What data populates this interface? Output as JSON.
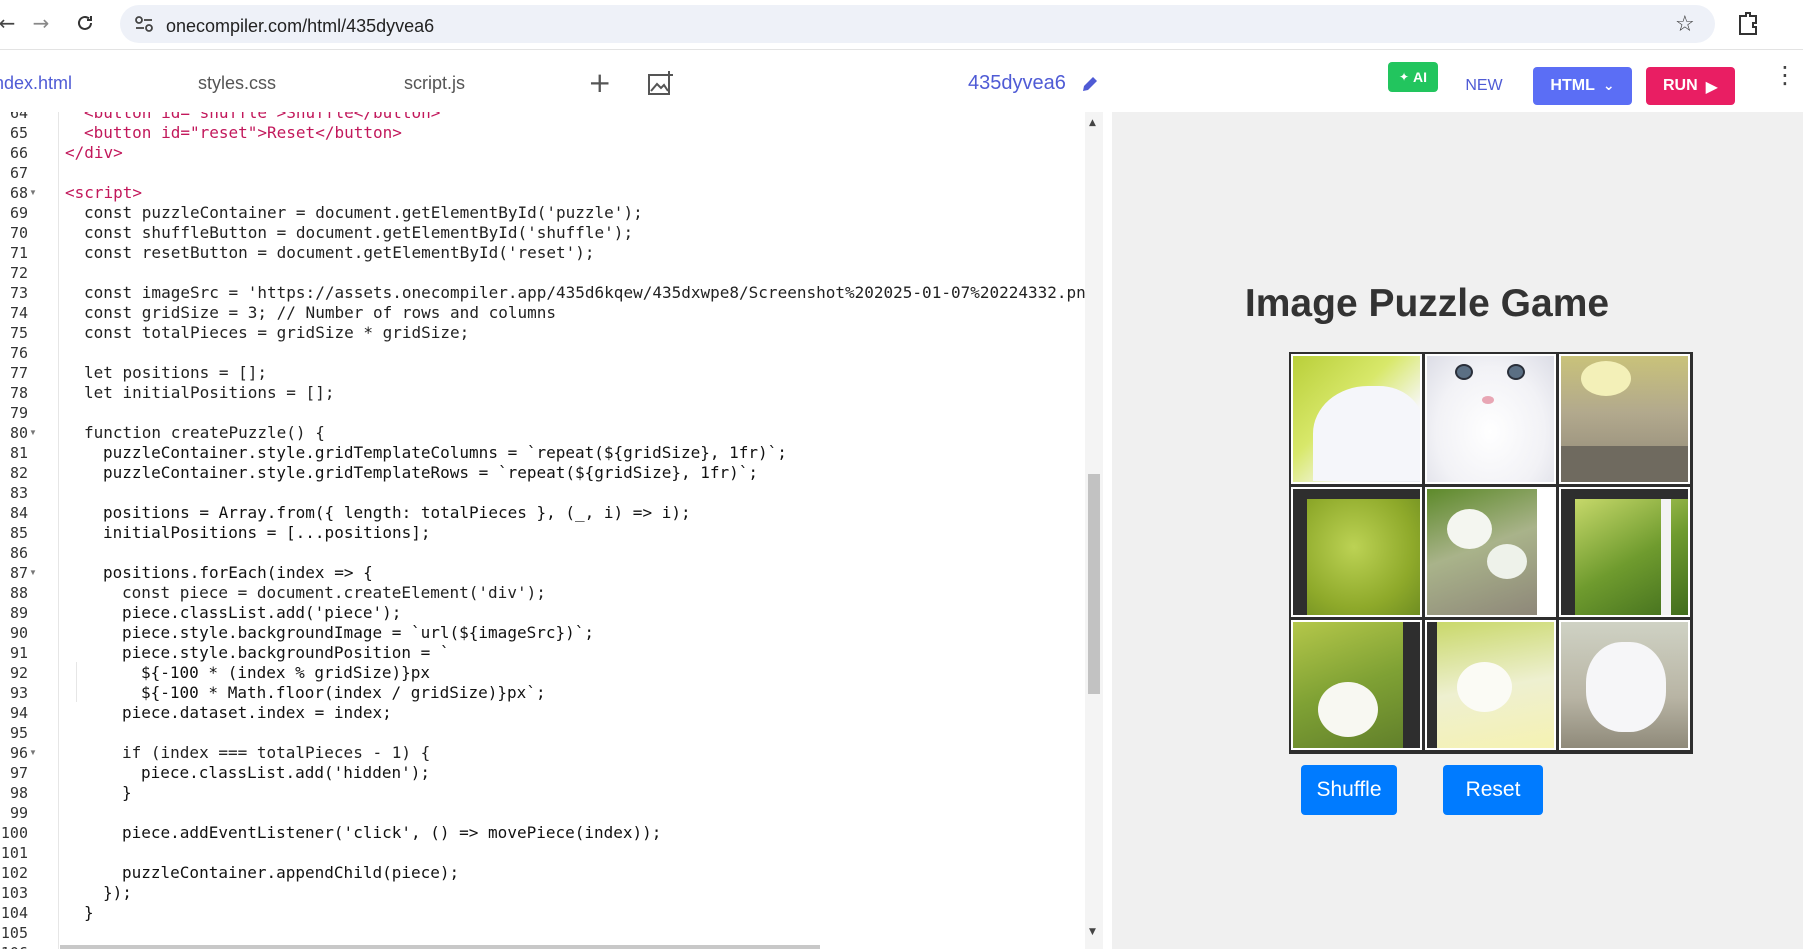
{
  "browser": {
    "url": "onecompiler.com/html/435dyvea6",
    "back_icon": "arrow-left-icon",
    "forward_icon": "arrow-right-icon",
    "reload_icon": "reload-icon"
  },
  "editor_tabs": {
    "tabs": [
      {
        "label": "index.html",
        "active": true
      },
      {
        "label": "styles.css",
        "active": false
      },
      {
        "label": "script.js",
        "active": false
      }
    ],
    "code_id": "435dyvea6"
  },
  "toolbar": {
    "ai_label": "AI",
    "new_label": "NEW",
    "lang_label": "HTML",
    "run_label": "RUN",
    "colors": {
      "accent": "#4f5bd5",
      "ai": "#22c55e",
      "run": "#e91e63"
    }
  },
  "code_lines": [
    {
      "n": "64",
      "text": "<button id=\"shuffle\">Shuffle</button>"
    },
    {
      "n": "65",
      "text": "<button id=\"reset\">Reset</button>"
    },
    {
      "n": "66",
      "text": "</div>"
    },
    {
      "n": "67",
      "text": ""
    },
    {
      "n": "68",
      "text": "<script>"
    },
    {
      "n": "69",
      "text": "const puzzleContainer = document.getElementById('puzzle');"
    },
    {
      "n": "70",
      "text": "const shuffleButton = document.getElementById('shuffle');"
    },
    {
      "n": "71",
      "text": "const resetButton = document.getElementById('reset');"
    },
    {
      "n": "72",
      "text": ""
    },
    {
      "n": "73",
      "text": "const imageSrc = 'https://assets.onecompiler.app/435d6kqew/435dxwpe8/Screenshot%202025-01-07%20224332.pn"
    },
    {
      "n": "74",
      "text": "const gridSize = 3; // Number of rows and columns"
    },
    {
      "n": "75",
      "text": "const totalPieces = gridSize * gridSize;"
    },
    {
      "n": "76",
      "text": ""
    },
    {
      "n": "77",
      "text": "let positions = [];"
    },
    {
      "n": "78",
      "text": "let initialPositions = [];"
    },
    {
      "n": "79",
      "text": ""
    },
    {
      "n": "80",
      "text": "function createPuzzle() {"
    },
    {
      "n": "81",
      "text": "puzzleContainer.style.gridTemplateColumns = `repeat(${gridSize}, 1fr)`;"
    },
    {
      "n": "82",
      "text": "puzzleContainer.style.gridTemplateRows = `repeat(${gridSize}, 1fr)`;"
    },
    {
      "n": "83",
      "text": ""
    },
    {
      "n": "84",
      "text": "positions = Array.from({ length: totalPieces }, (_, i) => i);"
    },
    {
      "n": "85",
      "text": "initialPositions = [...positions];"
    },
    {
      "n": "86",
      "text": ""
    },
    {
      "n": "87",
      "text": "positions.forEach(index => {"
    },
    {
      "n": "88",
      "text": "const piece = document.createElement('div');"
    },
    {
      "n": "89",
      "text": "piece.classList.add('piece');"
    },
    {
      "n": "90",
      "text": "piece.style.backgroundImage = `url(${imageSrc})`;"
    },
    {
      "n": "91",
      "text": "piece.style.backgroundPosition = `"
    },
    {
      "n": "92",
      "text": "${-100 * (index % gridSize)}px"
    },
    {
      "n": "93",
      "text": "${-100 * Math.floor(index / gridSize)}px`;"
    },
    {
      "n": "94",
      "text": "piece.dataset.index = index;"
    },
    {
      "n": "95",
      "text": ""
    },
    {
      "n": "96",
      "text": "if (index === totalPieces - 1) {"
    },
    {
      "n": "97",
      "text": "piece.classList.add('hidden');"
    },
    {
      "n": "98",
      "text": "}"
    },
    {
      "n": "99",
      "text": ""
    },
    {
      "n": "100",
      "text": "piece.addEventListener('click', () => movePiece(index));"
    },
    {
      "n": "101",
      "text": ""
    },
    {
      "n": "102",
      "text": "puzzleContainer.appendChild(piece);"
    },
    {
      "n": "103",
      "text": "});"
    },
    {
      "n": "104",
      "text": "}"
    },
    {
      "n": "105",
      "text": ""
    },
    {
      "n": "106",
      "text": "function shuffleArray(array) {"
    }
  ],
  "preview": {
    "title": "Image Puzzle Game",
    "shuffle_label": "Shuffle",
    "reset_label": "Reset",
    "pieces": [
      {
        "name": "kitten-left-cheek",
        "content": "white kitten fur on green background"
      },
      {
        "name": "kitten-face",
        "content": "white kitten face with blue eyes"
      },
      {
        "name": "stone-flowers",
        "content": "yellow flowers on stone"
      },
      {
        "name": "green-blur",
        "content": "blurred green background"
      },
      {
        "name": "white-flowers",
        "content": "white petunias on stone"
      },
      {
        "name": "green-leaves",
        "content": "green leaves"
      },
      {
        "name": "white-petunia",
        "content": "white petunia flower"
      },
      {
        "name": "flowers-cluster",
        "content": "white and yellow flowers"
      },
      {
        "name": "kitten-paw",
        "content": "white kitten paw on stone"
      }
    ]
  }
}
